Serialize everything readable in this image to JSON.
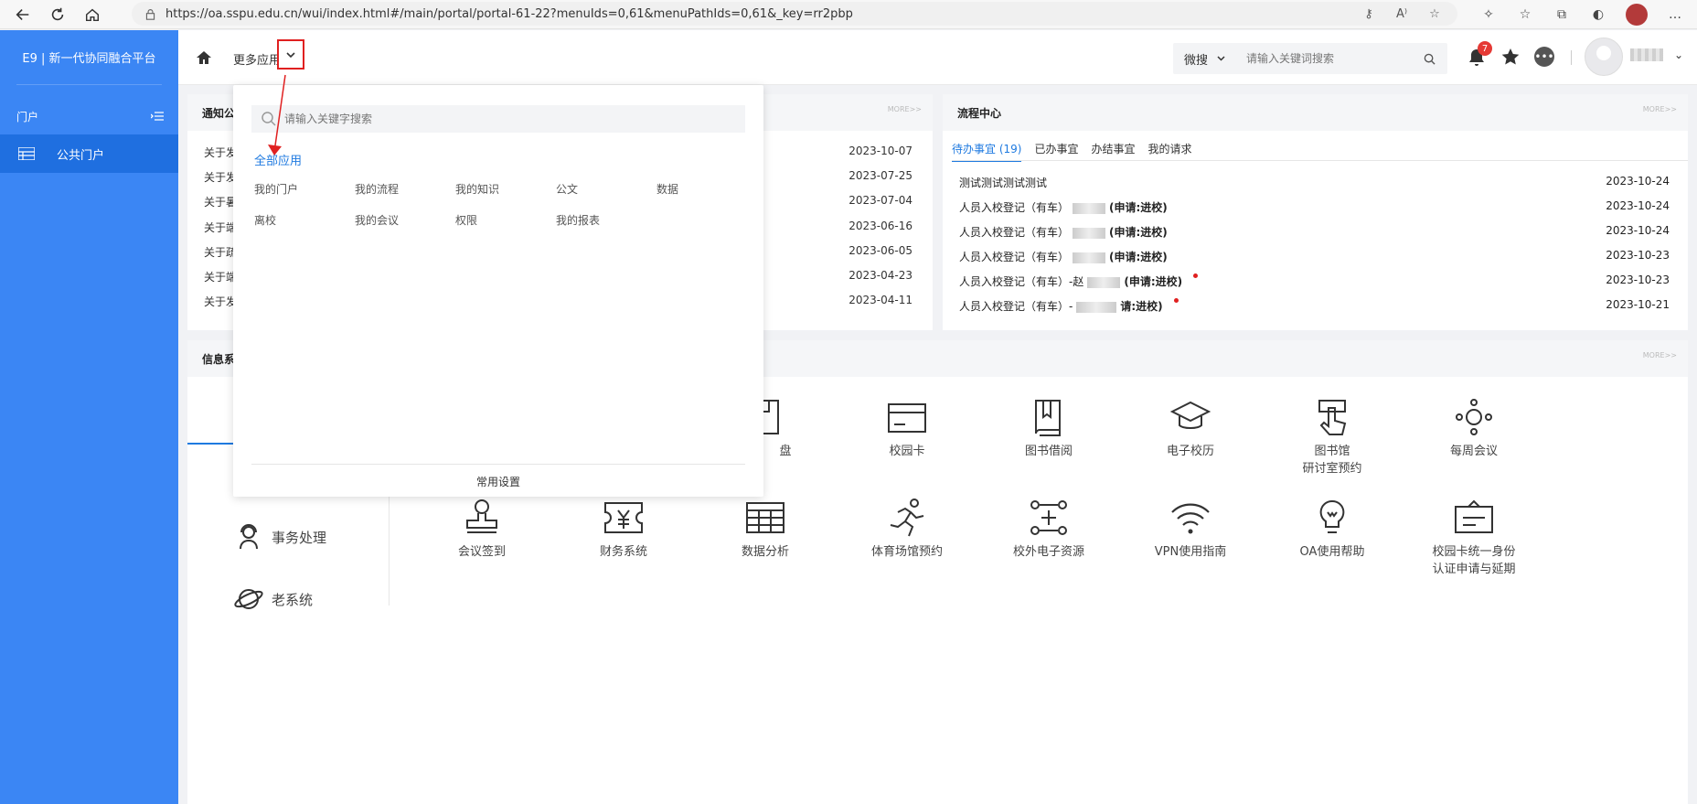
{
  "browser": {
    "url": "https://oa.sspu.edu.cn/wui/index.html#/main/portal/portal-61-22?menuIds=0,61&menuPathIds=0,61&_key=rr2pbp"
  },
  "sidebar": {
    "title": "E9 | 新一代协同融合平台",
    "section_label": "门户",
    "active_item": "公共门户"
  },
  "topbar": {
    "more_apps": "更多应用",
    "search_scope": "微搜",
    "search_placeholder": "请输入关键词搜索",
    "notification_count": "7"
  },
  "notice_card": {
    "title": "通知公",
    "more": "MORE>>",
    "rows": [
      {
        "title": "关于发",
        "date": "2023-10-07"
      },
      {
        "title": "关于发",
        "date": "2023-07-25"
      },
      {
        "title": "关于暑",
        "date": "2023-07-04"
      },
      {
        "title": "关于端",
        "date": "2023-06-16"
      },
      {
        "title": "关于疏",
        "date": "2023-06-05"
      },
      {
        "title": "关于端",
        "date": "2023-04-23"
      },
      {
        "title": "关于发",
        "date": "2023-04-11"
      }
    ]
  },
  "flow_card": {
    "title": "流程中心",
    "more": "MORE>>",
    "tabs": [
      "待办事宜 (19)",
      "已办事宜",
      "办结事宜",
      "我的请求"
    ],
    "rows": [
      {
        "title": "测试测试测试测试",
        "suffix": "",
        "date": "2023-10-24",
        "dot": false
      },
      {
        "title": "人员入校登记（有车）",
        "suffix": "(申请:进校)",
        "date": "2023-10-24",
        "dot": false
      },
      {
        "title": "人员入校登记（有车）",
        "suffix": "(申请:进校)",
        "date": "2023-10-24",
        "dot": false
      },
      {
        "title": "人员入校登记（有车）",
        "suffix": "(申请:进校)",
        "date": "2023-10-23",
        "dot": false
      },
      {
        "title": "人员入校登记（有车）-赵",
        "suffix": "(申请:进校)",
        "date": "2023-10-23",
        "dot": true
      },
      {
        "title": "人员入校登记（有车）-",
        "suffix": "请:进校)",
        "date": "2023-10-21",
        "dot": true
      }
    ]
  },
  "systems_card": {
    "title": "信息系",
    "more": "MORE>>",
    "left_items": [
      "事务处理",
      "老系统"
    ],
    "apps_row1": [
      {
        "label": "盘",
        "icon": "disk-icon"
      },
      {
        "label": "校园卡",
        "icon": "card-icon"
      },
      {
        "label": "图书借阅",
        "icon": "book-icon"
      },
      {
        "label": "电子校历",
        "icon": "graduation-cap-icon"
      },
      {
        "label": "图书馆\n研讨室预约",
        "icon": "hand-tap-icon"
      },
      {
        "label": "每周会议",
        "icon": "meeting-icon"
      }
    ],
    "apps_row2": [
      {
        "label": "会议签到",
        "icon": "stamp-icon"
      },
      {
        "label": "财务系统",
        "icon": "finance-icon"
      },
      {
        "label": "数据分析",
        "icon": "table-icon"
      },
      {
        "label": "体育场馆预约",
        "icon": "runner-icon"
      },
      {
        "label": "校外电子资源",
        "icon": "resource-icon"
      },
      {
        "label": "VPN使用指南",
        "icon": "wifi-icon"
      },
      {
        "label": "OA使用帮助",
        "icon": "lightbulb-icon"
      },
      {
        "label": "校园卡统一身份\n认证申请与延期",
        "icon": "id-card-icon"
      }
    ]
  },
  "popup": {
    "search_placeholder": "请输入关键字搜索",
    "all_apps": "全部应用",
    "items": [
      "我的门户",
      "我的流程",
      "我的知识",
      "公文",
      "数据",
      "离校",
      "我的会议",
      "权限",
      "我的报表"
    ],
    "footer": "常用设置"
  }
}
